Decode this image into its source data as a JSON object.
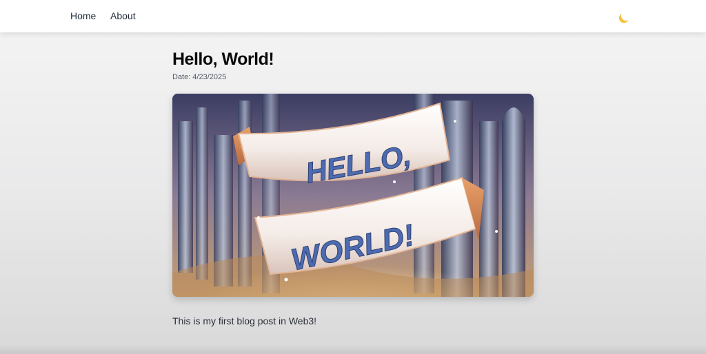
{
  "nav": {
    "home_label": "Home",
    "about_label": "About",
    "theme_toggle_icon": "moon-icon",
    "accent_color": "#f5c33b"
  },
  "post": {
    "title": "Hello, World!",
    "date_label": "Date:",
    "date_value": "4/23/2025",
    "image": {
      "icon": "hero-image",
      "banner_line1": "HELLO,",
      "banner_line2": "WORLD!"
    },
    "body": "This is my first blog post in Web3!"
  }
}
